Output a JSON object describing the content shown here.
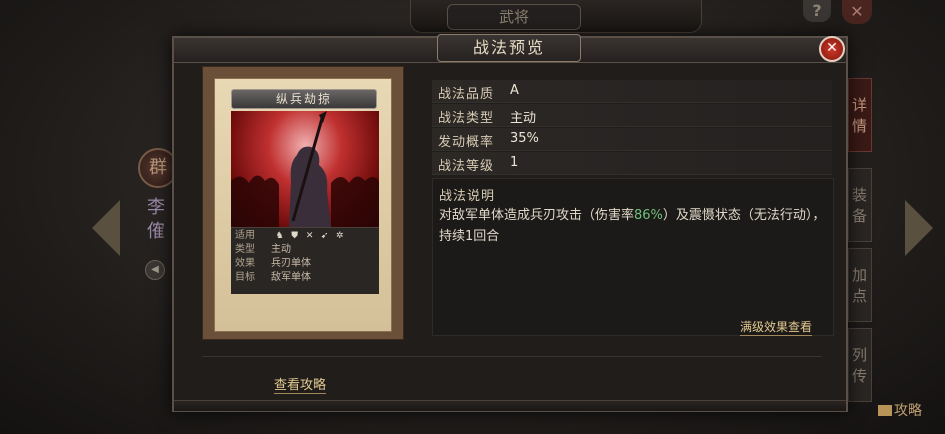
{
  "background": {
    "title": "武将",
    "help": "?",
    "close": "✕",
    "faction": "群",
    "general_name": "李傕",
    "side_tabs": [
      "详情",
      "装备",
      "加点",
      "列传"
    ],
    "guide": "攻略"
  },
  "dialog": {
    "title": "战法预览",
    "close": "✕",
    "card": {
      "name": "纵兵劫掠",
      "info": [
        {
          "key": "适用",
          "value": ""
        },
        {
          "key": "类型",
          "value": "主动"
        },
        {
          "key": "效果",
          "value": "兵刃单体"
        },
        {
          "key": "目标",
          "value": "敌军单体"
        }
      ],
      "apply_icons": [
        "cavalry-icon",
        "shield-icon",
        "bow-icon",
        "spear-icon",
        "wheel-icon"
      ]
    },
    "stats": [
      {
        "label": "战法品质",
        "value": "A"
      },
      {
        "label": "战法类型",
        "value": "主动"
      },
      {
        "label": "发动概率",
        "value": "35%"
      },
      {
        "label": "战法等级",
        "value": "1"
      }
    ],
    "description": {
      "title": "战法说明",
      "text_before": "对敌军单体造成兵刃攻击（伤害率",
      "highlight": "86%",
      "text_after": "）及震慑状态（无法行动），持续1回合"
    },
    "max_effect_link": "满级效果查看",
    "strategy_link": "查看攻略"
  }
}
